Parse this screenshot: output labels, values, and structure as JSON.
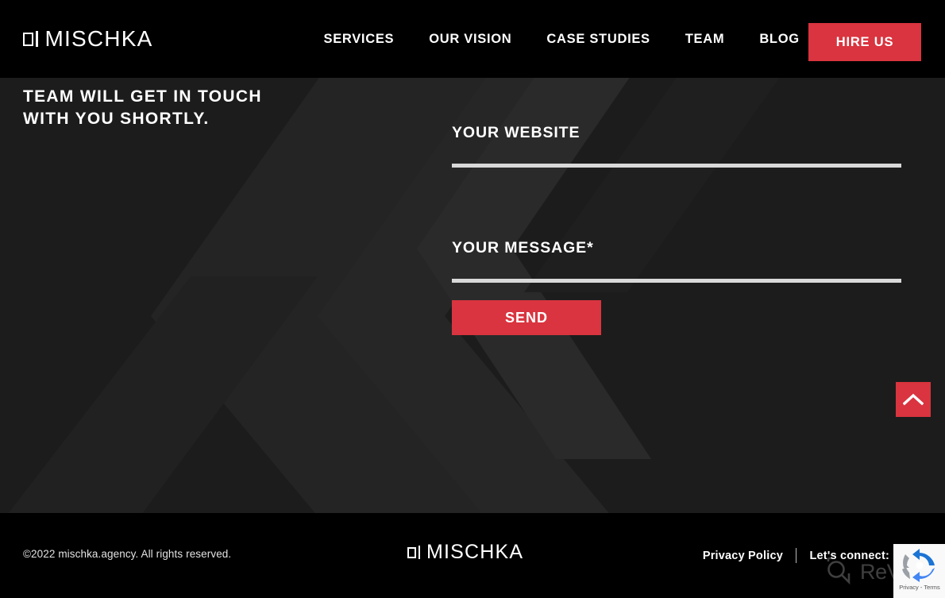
{
  "brand": {
    "name": "MISCHKA",
    "mark": "square-bar-logomark"
  },
  "header": {
    "nav": [
      {
        "label": "SERVICES"
      },
      {
        "label": "OUR VISION"
      },
      {
        "label": "CASE STUDIES"
      },
      {
        "label": "TEAM"
      },
      {
        "label": "BLOG"
      }
    ],
    "cta": {
      "label": "HIRE US",
      "color": "#d9343f"
    }
  },
  "main": {
    "heading": "TEAM WILL GET IN TOUCH WITH YOU SHORTLY.",
    "form": {
      "website": {
        "label": "YOUR WEBSITE",
        "value": "",
        "placeholder": ""
      },
      "message": {
        "label": "YOUR MESSAGE*",
        "value": "",
        "placeholder": ""
      },
      "submit": {
        "label": "SEND",
        "color": "#d9343f"
      }
    },
    "scroll_to_top": {
      "icon": "chevron-up-icon",
      "color": "#d9343f"
    }
  },
  "footer": {
    "copyright": "©2022 mischka.agency. All rights reserved.",
    "brand": "MISCHKA",
    "privacy_policy": "Privacy Policy",
    "connect_label": "Let's connect:"
  },
  "recaptcha": {
    "text": "Privacy - Terms",
    "icon": "recaptcha-icon"
  },
  "watermark": {
    "text": "ReVision",
    "icon": "revision-logo-icon"
  },
  "colors": {
    "accent": "#d9343f",
    "header_bg": "#000000",
    "main_bg": "#1c1c1c",
    "footer_bg": "#000000",
    "underline": "#d9d9d9"
  }
}
